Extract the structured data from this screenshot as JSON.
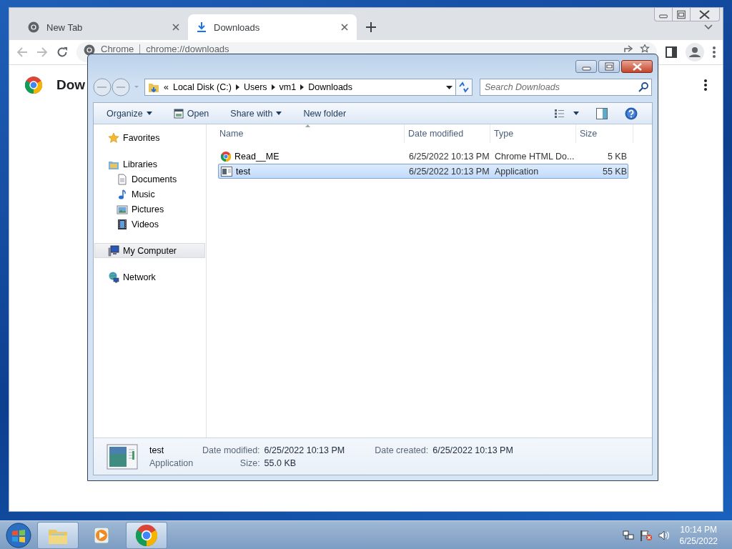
{
  "browser": {
    "tabs": [
      {
        "title": "New Tab",
        "kind": "chrome",
        "selected": false
      },
      {
        "title": "Downloads",
        "kind": "download",
        "selected": true
      }
    ],
    "omnibox": {
      "site": "Chrome",
      "url": "chrome://downloads"
    },
    "page_heading": "Dow"
  },
  "explorer": {
    "overflow": "«",
    "breadcrumb": [
      "Local Disk (C:)",
      "Users",
      "vm1",
      "Downloads"
    ],
    "search": {
      "placeholder": "Search Downloads"
    },
    "toolbar": [
      {
        "label": "Organize",
        "kind": "menu"
      },
      {
        "label": "Open",
        "kind": "open"
      },
      {
        "label": "Share with",
        "kind": "menu"
      },
      {
        "label": "New folder",
        "kind": "plain"
      }
    ],
    "nav": [
      {
        "label": "Favorites",
        "kind": "star",
        "selected": false
      },
      {
        "label": "Libraries",
        "kind": "library",
        "selected": false,
        "children": [
          {
            "label": "Documents",
            "kind": "document",
            "selected": false
          },
          {
            "label": "Music",
            "kind": "music",
            "selected": false
          },
          {
            "label": "Pictures",
            "kind": "pictures",
            "selected": false
          },
          {
            "label": "Videos",
            "kind": "videos",
            "selected": false
          }
        ]
      },
      {
        "label": "My Computer",
        "kind": "computer",
        "selected": true
      },
      {
        "label": "Network",
        "kind": "network",
        "selected": false
      }
    ],
    "columns": [
      "Name",
      "Date modified",
      "Type",
      "Size"
    ],
    "files": [
      {
        "name": "Read__ME",
        "modified": "6/25/2022 10:13 PM",
        "type": "Chrome HTML Do...",
        "size": "5 KB",
        "kind": "chrome",
        "selected": false
      },
      {
        "name": "test",
        "modified": "6/25/2022 10:13 PM",
        "type": "Application",
        "size": "55 KB",
        "kind": "app",
        "selected": true
      }
    ],
    "details": {
      "name": "test",
      "type": "Application",
      "fields": [
        {
          "label": "Date modified:",
          "value": "6/25/2022 10:13 PM"
        },
        {
          "label": "Date created:",
          "value": "6/25/2022 10:13 PM"
        },
        {
          "label": "Size:",
          "value": "55.0 KB"
        }
      ]
    }
  },
  "taskbar": {
    "items": [
      {
        "kind": "explorer",
        "active": true
      },
      {
        "kind": "media",
        "active": false
      },
      {
        "kind": "chrome",
        "active": true
      }
    ],
    "clock": {
      "time": "10:14 PM",
      "date": "6/25/2022"
    }
  }
}
